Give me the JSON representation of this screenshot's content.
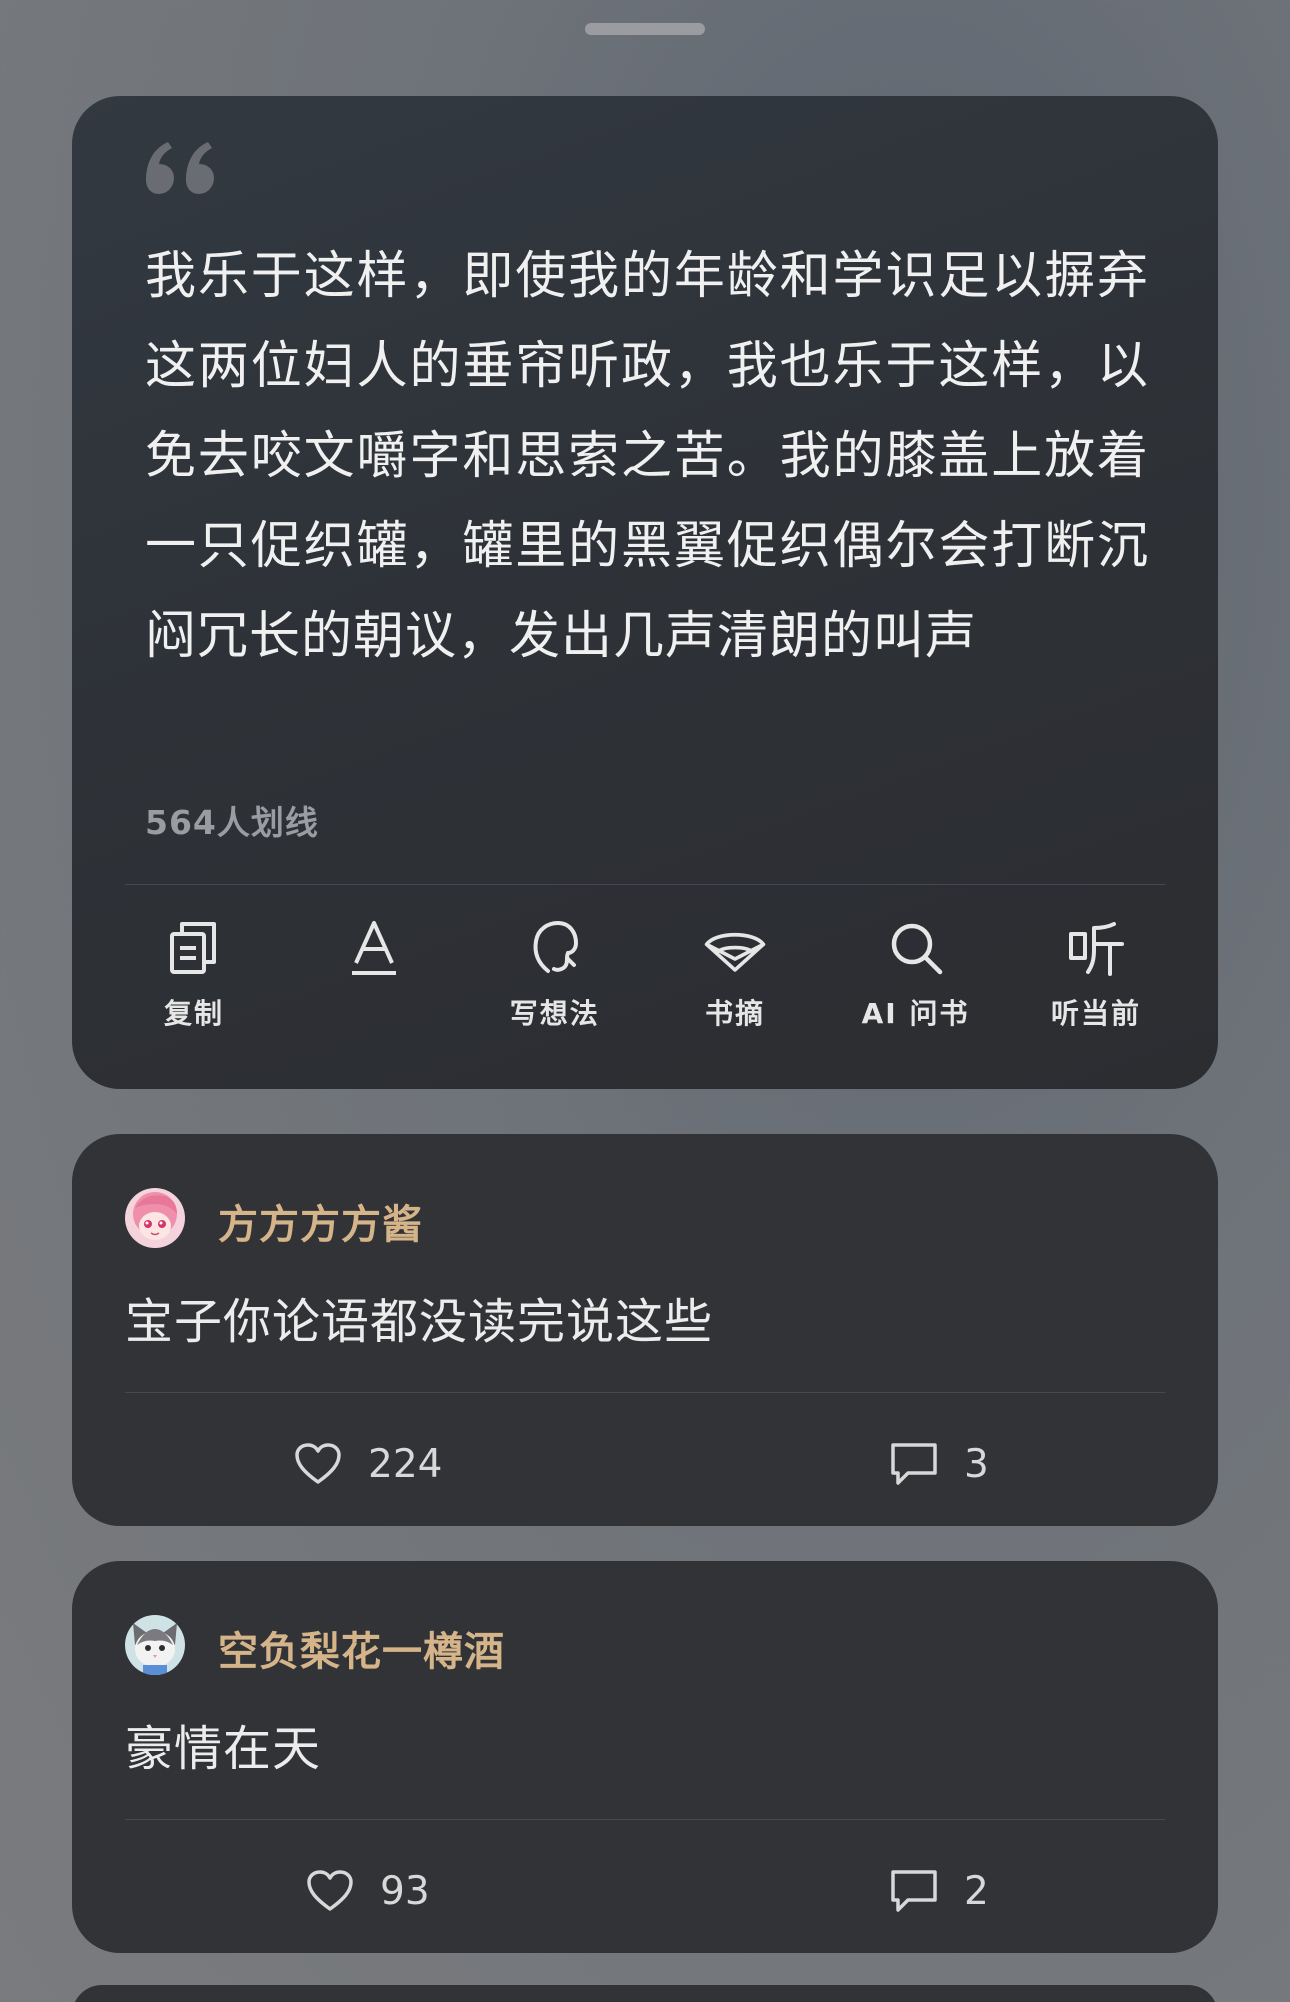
{
  "quote": {
    "text": "我乐于这样，即使我的年龄和学识足以摒弃这两位妇人的垂帘听政，我也乐于这样，以免去咬文嚼字和思索之苦。我的膝盖上放着一只促织罐，罐里的黑翼促织偶尔会打断沉闷冗长的朝议，发出几声清朗的叫声",
    "highlight_count": "564人划线",
    "actions": [
      {
        "label": "复制",
        "icon": "copy-icon"
      },
      {
        "label": "",
        "icon": "font-icon"
      },
      {
        "label": "写想法",
        "icon": "thought-icon"
      },
      {
        "label": "书摘",
        "icon": "bookmark-icon"
      },
      {
        "label": "AI 问书",
        "icon": "search-icon"
      },
      {
        "label": "听当前",
        "icon": "listen-icon"
      }
    ]
  },
  "comments": [
    {
      "username": "方方方方酱",
      "text": "宝子你论语都没读完说这些",
      "likes": "224",
      "replies": "3"
    },
    {
      "username": "空负梨花一樽酒",
      "text": "豪情在天",
      "likes": "93",
      "replies": "2"
    }
  ],
  "colors": {
    "username": "#d5b48a",
    "card_bg": "#323337",
    "quote_bg": "#2d3035"
  }
}
